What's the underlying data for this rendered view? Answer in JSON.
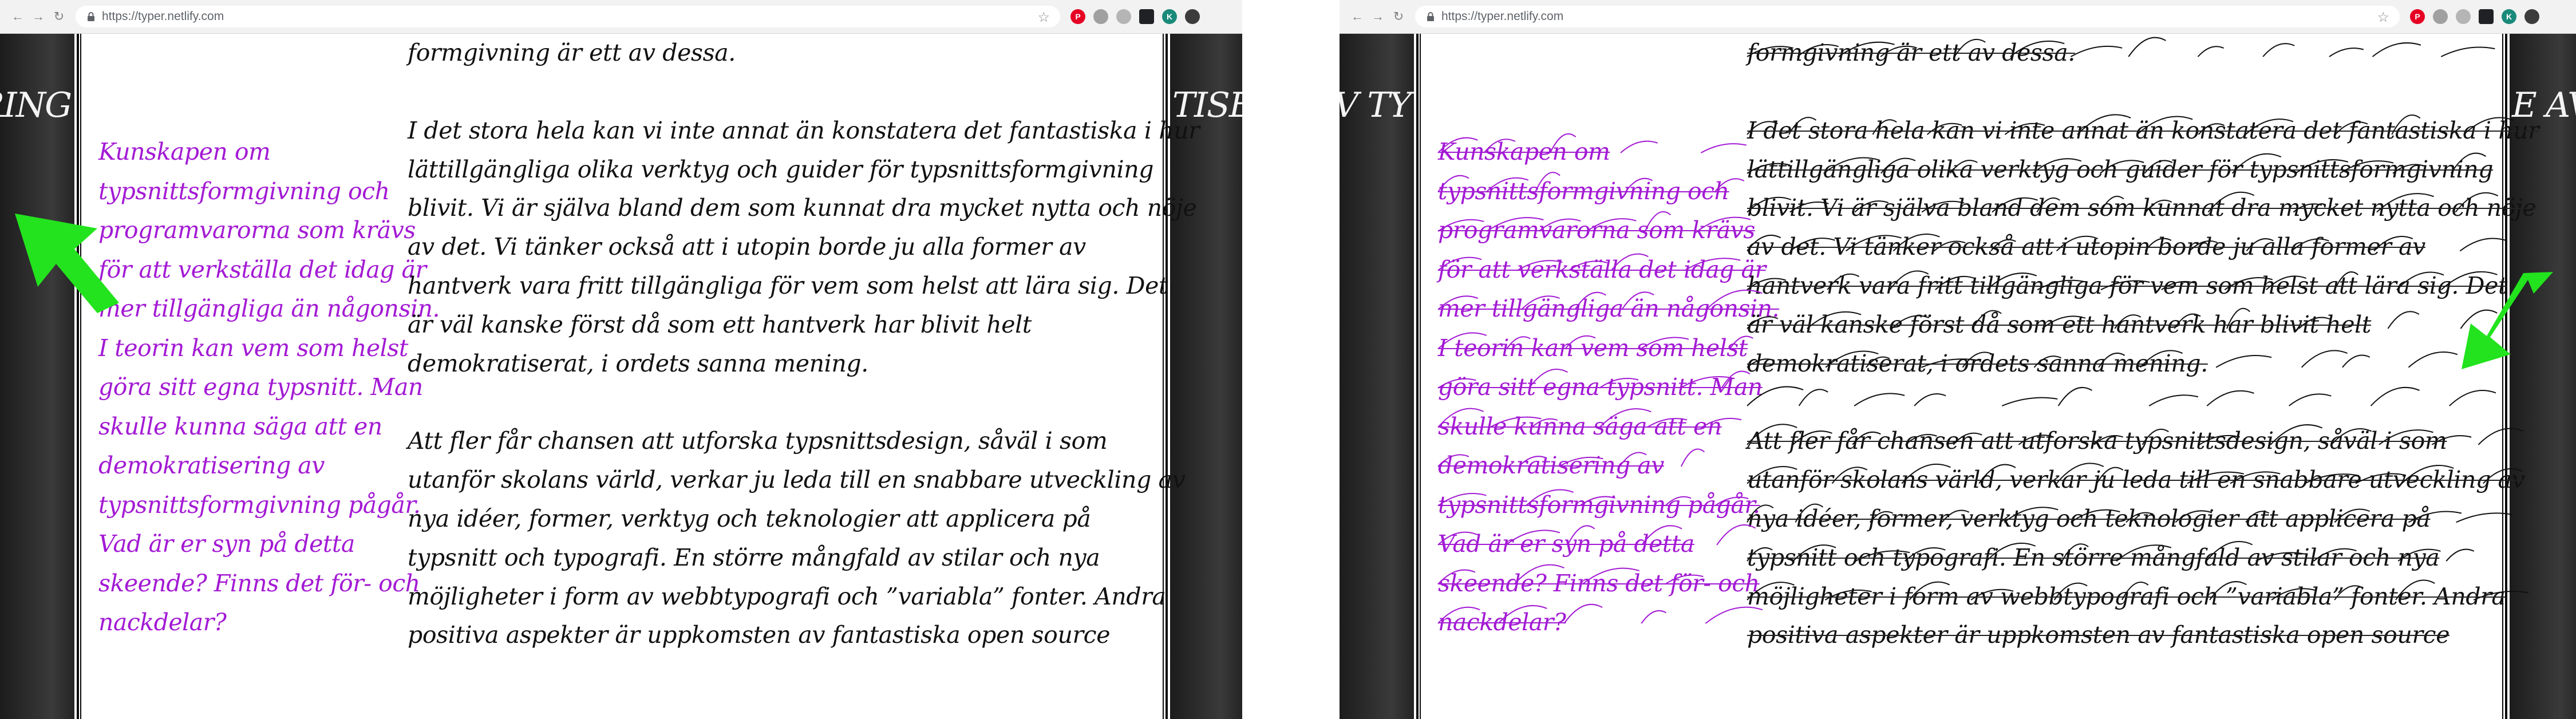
{
  "browser": {
    "url": "https://typer.netlify.com",
    "back_icon": "back-arrow-icon",
    "forward_icon": "forward-arrow-icon",
    "reload_icon": "reload-icon",
    "lock_icon": "lock-icon",
    "bookmark_icon": "star-icon",
    "extensions": [
      {
        "name": "pinterest-extension-icon",
        "color": "#e60023",
        "glyph": "P"
      },
      {
        "name": "shield-extension-icon",
        "color": "#a0a0a0",
        "glyph": ""
      },
      {
        "name": "grey-extension-icon",
        "color": "#b5b5b5",
        "glyph": ""
      },
      {
        "name": "dark-extension-icon",
        "color": "#202124",
        "glyph": ""
      },
      {
        "name": "profile-avatar-icon",
        "color": "#1a8a7a",
        "glyph": "K"
      },
      {
        "name": "settings-extension-icon",
        "color": "#3c3c3c",
        "glyph": ""
      }
    ]
  },
  "left_window": {
    "band_left_text": "ƎRING",
    "band_right_text": "TISE",
    "aside_lines": [
      "Kunskapen om",
      "typsnittsformgivning och",
      "programvarorna som krävs",
      "för att verkställa det idag är",
      "mer tillgängliga än någonsin.",
      "I teorin kan vem som helst",
      "göra sitt egna typsnitt. Man",
      "skulle kunna säga att en",
      "demokratisering av",
      "typsnittsformgivning pågår.",
      "Vad är er syn på detta",
      "skeende? Finns det för- och",
      "nackdelar?"
    ]
  },
  "right_window": {
    "band_left_text": "AV TY",
    "band_right_text": "E AV"
  },
  "article": {
    "top_line": "formgivning är ett av dessa.",
    "paragraph1": [
      "I det stora hela kan vi inte annat än konstatera det fantastiska i hur",
      "lättillgängliga olika verktyg och guider för typsnittsformgivning",
      "blivit. Vi är själva bland dem som kunnat dra mycket nytta och nöje",
      "av det. Vi tänker också att i utopin borde ju alla former av",
      "hantverk vara fritt tillgängliga för vem som helst att lära sig. Det",
      "är väl kanske först då som ett hantverk har blivit helt",
      "demokratiserat, i ordets sanna mening."
    ],
    "paragraph2": [
      "Att fler får chansen att utforska typsnittsdesign, såväl i som",
      "utanför skolans värld, verkar ju leda till en snabbare utveckling av",
      "nya idéer, former, verktyg och teknologier att applicera på",
      "typsnitt och typografi. En större mångfald av stilar och nya",
      "möjligheter i form av webbtypografi och ”variabla” fonter. Andra",
      "positiva aspekter är uppkomsten av fantastiska open source"
    ]
  },
  "colors": {
    "aside_text": "#a31ad4",
    "body_text": "#111111",
    "cursor": "#22e31d",
    "band": "#2a2a2a"
  }
}
